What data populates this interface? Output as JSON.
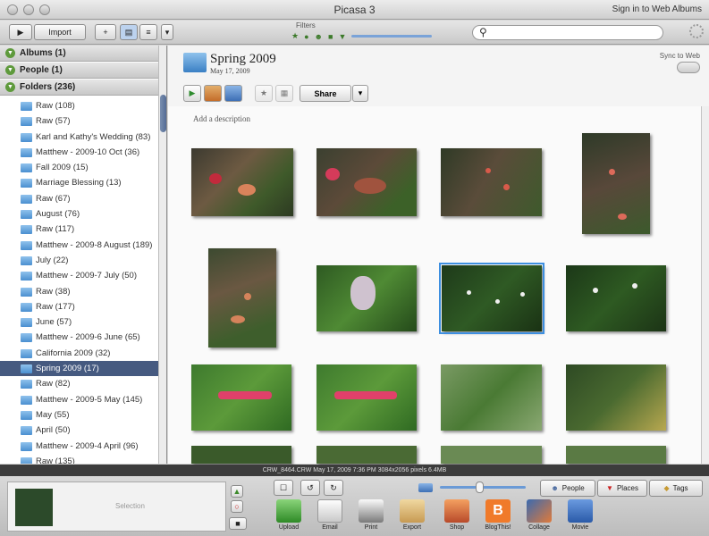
{
  "window": {
    "title": "Picasa 3",
    "signin": "Sign in to Web Albums"
  },
  "toolbar": {
    "import_label": "Import",
    "filters_label": "Filters"
  },
  "sidebar": {
    "sections": [
      {
        "label": "Albums (1)"
      },
      {
        "label": "People (1)"
      },
      {
        "label": "Folders (236)"
      }
    ],
    "folders": [
      {
        "label": "Raw (108)"
      },
      {
        "label": "Raw (57)"
      },
      {
        "label": "Karl and Kathy's Wedding (83)"
      },
      {
        "label": "Matthew - 2009-10 Oct (36)"
      },
      {
        "label": "Fall 2009 (15)"
      },
      {
        "label": "Marriage Blessing (13)"
      },
      {
        "label": "Raw (67)"
      },
      {
        "label": "August (76)"
      },
      {
        "label": "Raw (117)"
      },
      {
        "label": "Matthew - 2009-8 August (189)"
      },
      {
        "label": "July (22)"
      },
      {
        "label": "Matthew - 2009-7 July (50)"
      },
      {
        "label": "Raw (38)"
      },
      {
        "label": "Raw (177)"
      },
      {
        "label": "June (57)"
      },
      {
        "label": "Matthew - 2009-6 June (65)"
      },
      {
        "label": "California 2009 (32)"
      },
      {
        "label": "Spring 2009 (17)",
        "selected": true
      },
      {
        "label": "Raw (82)"
      },
      {
        "label": "Matthew - 2009-5 May (145)"
      },
      {
        "label": "May (55)"
      },
      {
        "label": "April (50)"
      },
      {
        "label": "Matthew - 2009-4 April (96)"
      },
      {
        "label": "Raw (135)"
      }
    ]
  },
  "main": {
    "folder_title": "Spring 2009",
    "folder_date": "May 17, 2009",
    "sync_label": "Sync to Web",
    "share_label": "Share",
    "description_placeholder": "Add a description"
  },
  "status": {
    "text": "CRW_8464.CRW    May 17, 2009 7:36 PM    3084x2056 pixels    6.4MB"
  },
  "tray": {
    "selection_label": "Selection",
    "people_label": "People",
    "places_label": "Places",
    "tags_label": "Tags",
    "actions": [
      "Upload",
      "Email",
      "Print",
      "Export",
      "Shop",
      "BlogThis!",
      "Collage",
      "Movie"
    ]
  },
  "colors": {
    "selection": "#465a80",
    "photo_selected_border": "#3d8fe0",
    "accent_green": "#3c7a2a"
  }
}
